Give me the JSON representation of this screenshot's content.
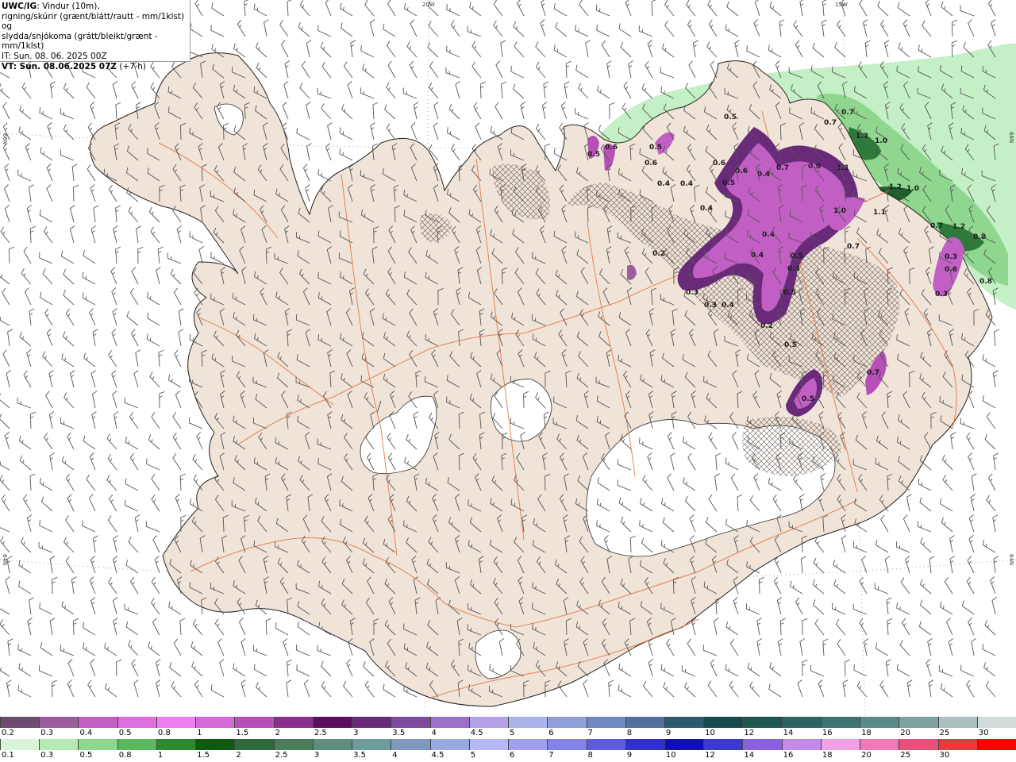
{
  "header": {
    "source": "UWC/IG",
    "title_rest": ": Vindur (10m),",
    "line2": "rigning/skúrir (grænt/blátt/rautt - mm/1klst) og",
    "line3": "slydda/snjókoma (grátt/bleikt/grænt - mm/1klst)",
    "it": "IT: Sun. 08. 06. 2025 00Z",
    "vt_prefix": "VT: Sun. 08.06.2025 07Z",
    "vt_suffix": " (+7 h)"
  },
  "coordinates": {
    "top_20w": "20W",
    "top_15w": "15W",
    "left_66n": "66N",
    "right_66n": "66N",
    "left_64n": "64N",
    "right_64n": "64N"
  },
  "precip_labels": [
    "0.5",
    "0.7",
    "0.7",
    "0.6",
    "0.5",
    "0.6",
    "0.6",
    "0.4",
    "0.4",
    "0.6",
    "0.4",
    "0.7",
    "0.6",
    "1.1",
    "1.2",
    "1.0",
    "1.0",
    "1.1",
    "1.2",
    "1.0",
    "0.4",
    "0.4",
    "0.4",
    "0.5",
    "0.4",
    "0.5",
    "0.5",
    "0.3",
    "0.3",
    "0.4",
    "0.2",
    "0.5",
    "0.7",
    "0.5",
    "0.7",
    "1.2",
    "0.8",
    "0.3",
    "0.6",
    "0.3",
    "0.8",
    "0.7",
    "0.5",
    "0.2"
  ],
  "legend": {
    "snow_labels": [
      "0.2",
      "0.3",
      "0.4",
      "0.5",
      "0.8",
      "1",
      "1.5",
      "2",
      "2.5",
      "3",
      "3.5",
      "4",
      "4.5",
      "5",
      "6",
      "7",
      "8",
      "9",
      "10",
      "12",
      "14",
      "16",
      "18",
      "20",
      "25",
      "30"
    ],
    "snow_colors": [
      "#6e4b70",
      "#9c5d9e",
      "#c25fc4",
      "#de6fe0",
      "#f07ef2",
      "#d66ad8",
      "#b64fb8",
      "#8a2f8c",
      "#5a0f5c",
      "#6a2a7a",
      "#7e4a9e",
      "#9a70c8",
      "#b4a0e6",
      "#a8b4ea",
      "#8fa0d8",
      "#7088c0",
      "#52709e",
      "#2e5a6e",
      "#174a4e",
      "#1e5652",
      "#2c6462",
      "#3e7472",
      "#5a8a88",
      "#7ea2a0",
      "#a8c0be",
      "#d2dcda"
    ],
    "rain_labels": [
      "0.1",
      "0.3",
      "0.5",
      "0.8",
      "1",
      "1.5",
      "2",
      "2.5",
      "3",
      "3.5",
      "4",
      "4.5",
      "5",
      "6",
      "7",
      "8",
      "9",
      "10",
      "12",
      "14",
      "16",
      "18",
      "20",
      "25",
      "30"
    ],
    "rain_colors": [
      "#d8f5d8",
      "#b4eab4",
      "#8ed88e",
      "#5cb85c",
      "#2e8a2e",
      "#0f5a0f",
      "#2e6a3c",
      "#4a7e5a",
      "#5e8e7e",
      "#6c9c9c",
      "#7e98c2",
      "#98a8e0",
      "#b4b8f4",
      "#a0a0f0",
      "#8282e8",
      "#5c5cdc",
      "#3030c8",
      "#1010b0",
      "#3a3acc",
      "#8a60e0",
      "#c48ae8",
      "#f0a0e4",
      "#f07ab8",
      "#e8507a",
      "#e83a3a",
      "#ff0000"
    ]
  }
}
